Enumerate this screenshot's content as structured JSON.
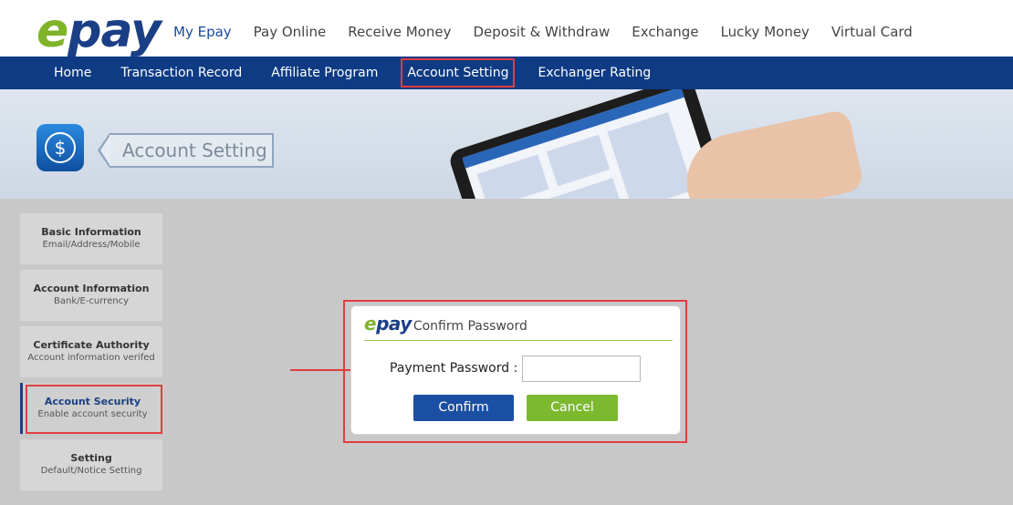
{
  "logo": {
    "text": "epay"
  },
  "main_nav": [
    {
      "label": "My Epay",
      "active": true
    },
    {
      "label": "Pay Online"
    },
    {
      "label": "Receive Money"
    },
    {
      "label": "Deposit & Withdraw"
    },
    {
      "label": "Exchange"
    },
    {
      "label": "Lucky Money"
    },
    {
      "label": "Virtual Card"
    }
  ],
  "sub_nav": [
    {
      "label": "Home"
    },
    {
      "label": "Transaction Record"
    },
    {
      "label": "Affiliate Program"
    },
    {
      "label": "Account Setting",
      "highlighted": true
    },
    {
      "label": "Exchanger Rating"
    }
  ],
  "banner": {
    "title": "Account Setting",
    "icon": "dollar-icon"
  },
  "sidebar": {
    "items": [
      {
        "title": "Basic Information",
        "subtitle": "Email/Address/Mobile"
      },
      {
        "title": "Account Information",
        "subtitle": "Bank/E-currency"
      },
      {
        "title": "Certificate Authority",
        "subtitle": "Account information verifed"
      },
      {
        "title": "Account Security",
        "subtitle": "Enable account security",
        "active": true
      },
      {
        "title": "Setting",
        "subtitle": "Default/Notice Setting"
      }
    ]
  },
  "dialog": {
    "logo_text": "epay",
    "title": "Confirm Password",
    "password_label": "Payment Password :",
    "password_value": "",
    "confirm_label": "Confirm",
    "cancel_label": "Cancel"
  },
  "colors": {
    "brand_blue": "#0e3b84",
    "brand_green": "#7fb32a",
    "highlight_red": "#e23d3d",
    "confirm_button": "#1b4fa3",
    "cancel_button": "#7cb92e"
  }
}
